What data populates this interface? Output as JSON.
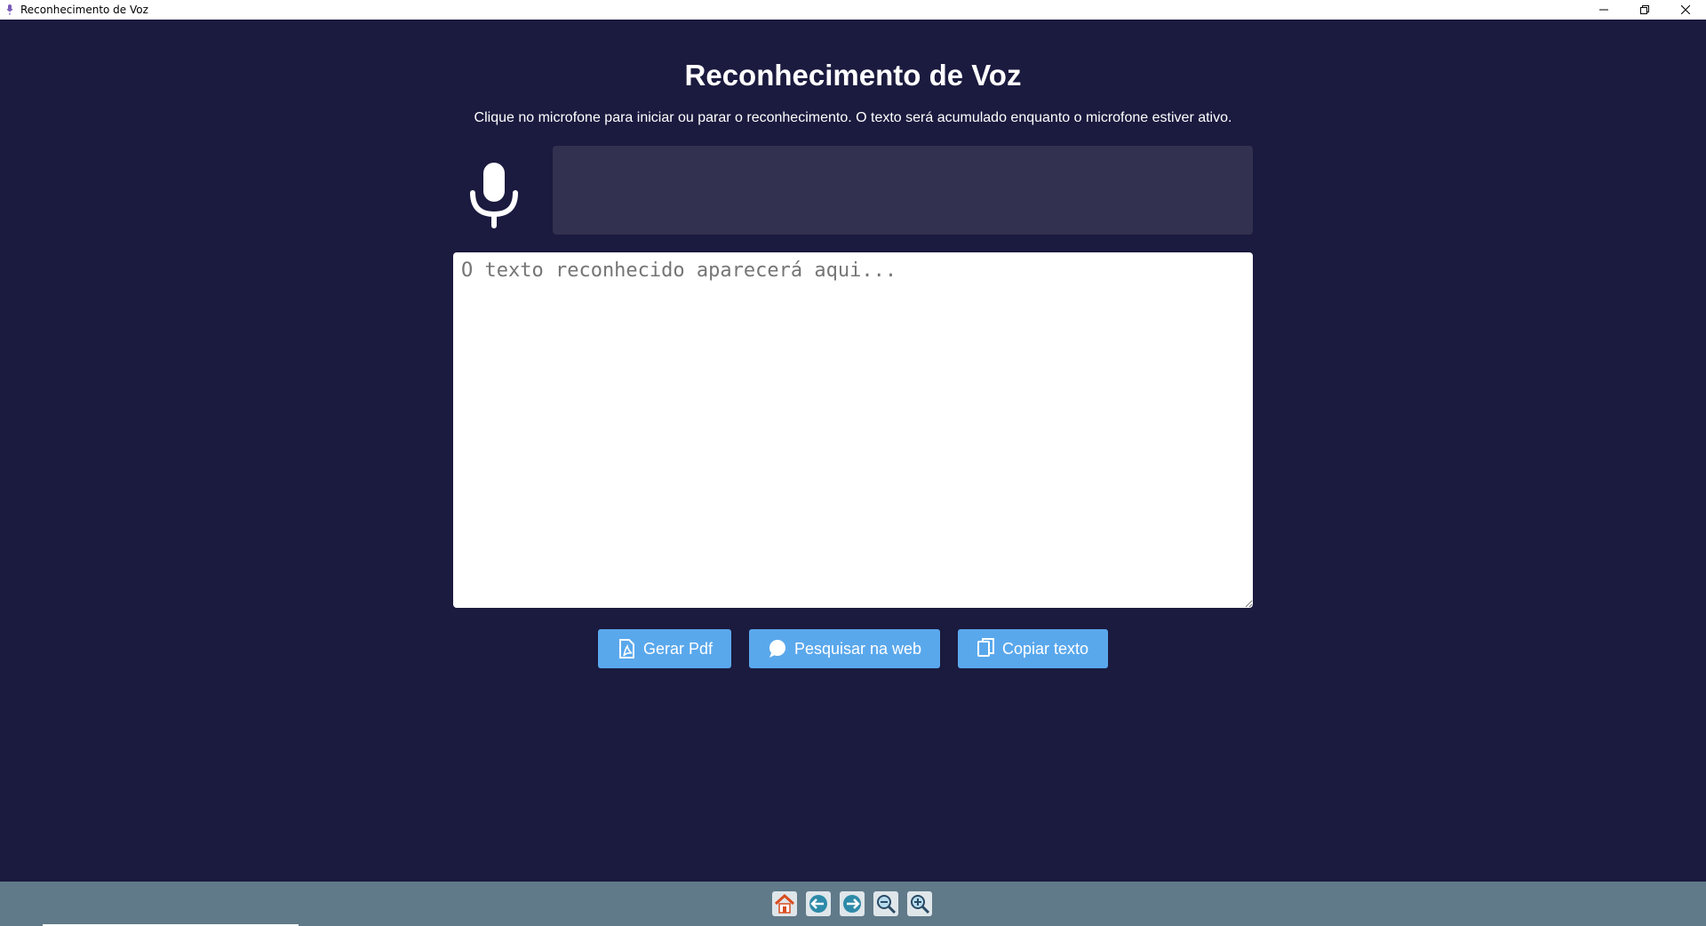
{
  "window": {
    "title": "Reconhecimento de Voz"
  },
  "main": {
    "heading": "Reconhecimento de Voz",
    "subtitle": "Clique no microfone para iniciar ou parar o reconhecimento. O texto será acumulado enquanto o microfone estiver ativo.",
    "mic_icon": "microphone-icon",
    "status_text": "",
    "textarea": {
      "value": "",
      "placeholder": "O texto reconhecido aparecerá aqui..."
    }
  },
  "actions": {
    "pdf_label": "Gerar Pdf",
    "search_label": "Pesquisar na web",
    "copy_label": "Copiar texto"
  },
  "toolbar": {
    "icons": [
      "home-icon",
      "arrow-left-icon",
      "arrow-right-icon",
      "zoom-out-icon",
      "zoom-in-icon"
    ]
  },
  "colors": {
    "background": "#1b1a3f",
    "status_box": "#32314f",
    "button": "#5aa8ec",
    "toolbar": "#607a89"
  }
}
